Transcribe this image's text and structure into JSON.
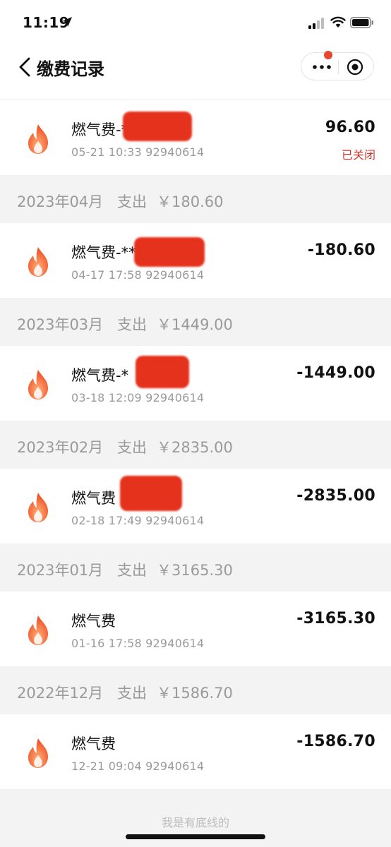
{
  "status": {
    "time": "11:19"
  },
  "nav": {
    "title": "缴费记录"
  },
  "records_top": {
    "title": "燃气费-*",
    "sub": "05-21 10:33 92940614",
    "amount": "96.60",
    "status": "已关闭"
  },
  "groups": [
    {
      "month": "2023年04月",
      "label": "支出",
      "amount": "￥180.60",
      "record": {
        "title": "燃气费-**",
        "sub": "04-17 17:58 92940614",
        "amount": "-180.60"
      }
    },
    {
      "month": "2023年03月",
      "label": "支出",
      "amount": "￥1449.00",
      "record": {
        "title": "燃气费-*",
        "sub": "03-18 12:09 92940614",
        "amount": "-1449.00"
      }
    },
    {
      "month": "2023年02月",
      "label": "支出",
      "amount": "￥2835.00",
      "record": {
        "title": "燃气费",
        "sub": "02-18 17:49 92940614",
        "amount": "-2835.00"
      }
    },
    {
      "month": "2023年01月",
      "label": "支出",
      "amount": "￥3165.30",
      "record": {
        "title": "燃气费",
        "sub": "01-16 17:58 92940614",
        "amount": "-3165.30"
      }
    },
    {
      "month": "2022年12月",
      "label": "支出",
      "amount": "￥1586.70",
      "record": {
        "title": "燃气费",
        "sub": "12-21 09:04 92940614",
        "amount": "-1586.70"
      }
    }
  ],
  "footer": {
    "text": "我是有底线的"
  },
  "colors": {
    "accent_red": "#d4342a",
    "flame_orange": "#f2703a",
    "section_bg": "#f3f3f3"
  },
  "icons": [
    "location-arrow-icon",
    "signal-icon",
    "wifi-icon",
    "battery-icon",
    "back-chevron-icon",
    "more-icon",
    "target-icon",
    "flame-icon"
  ]
}
